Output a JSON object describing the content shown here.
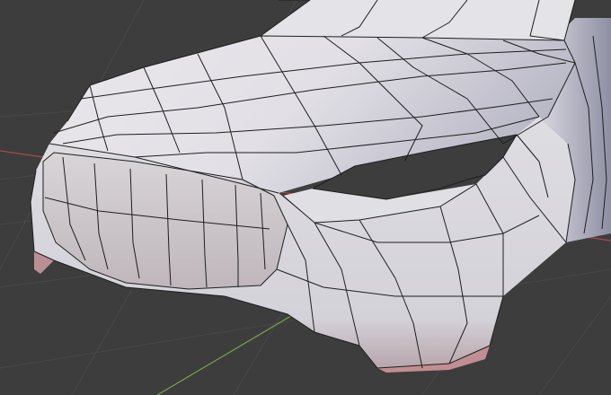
{
  "viewport": {
    "background": "#3d3d3d",
    "grid_color": "#494949",
    "x_axis_color": "#a94b4b",
    "y_axis_color": "#73a84a",
    "wireframe_color": "#1e1e1e",
    "mesh_base_color": "#e8e6e9",
    "mesh_shadow_color": "#8b8a9a",
    "mesh_underside_color": "#c99a9a"
  },
  "scene": {
    "object": "car-front-mesh",
    "shading": "solid",
    "overlay": "wireframe"
  }
}
